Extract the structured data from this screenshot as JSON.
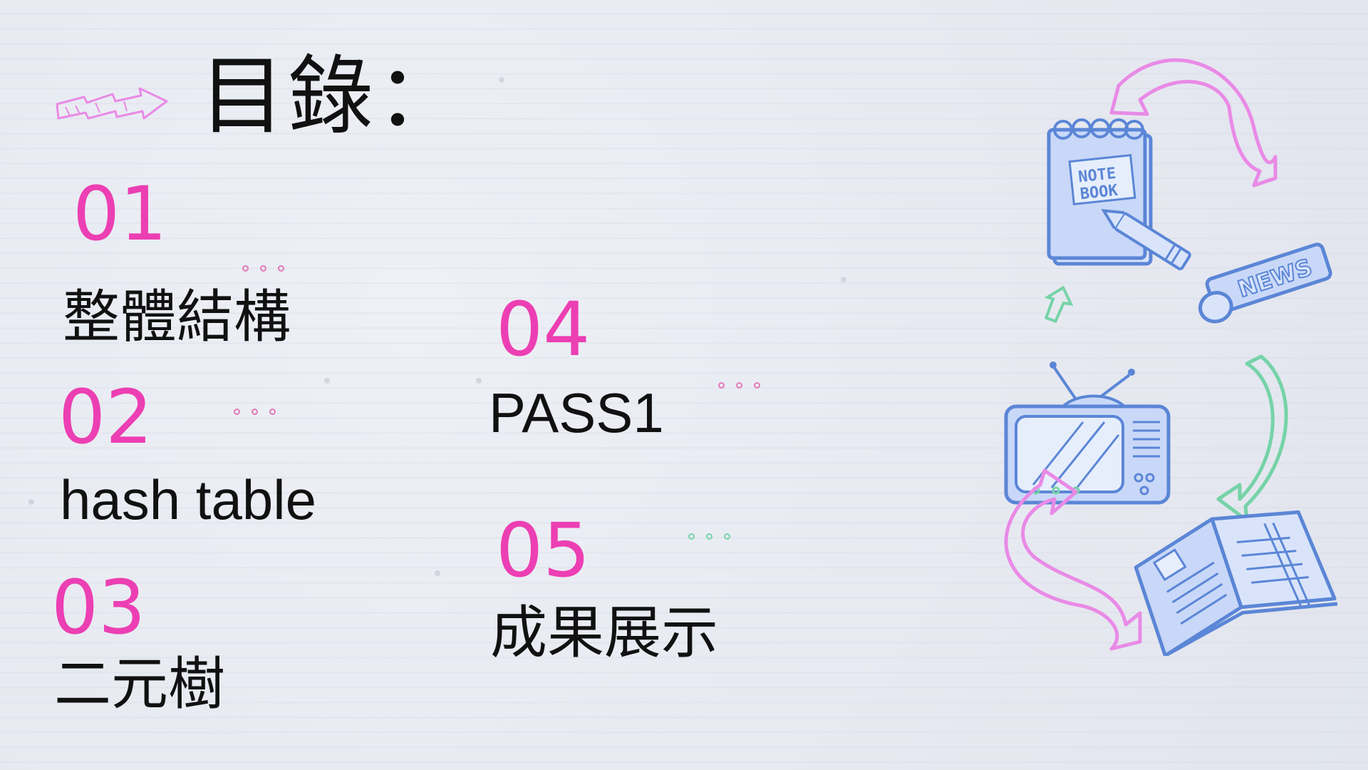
{
  "title": "目錄：",
  "items": [
    {
      "number": "01",
      "label": "整體結構"
    },
    {
      "number": "02",
      "label": "hash table"
    },
    {
      "number": "03",
      "label": "二元樹"
    },
    {
      "number": "04",
      "label": "PASS1"
    },
    {
      "number": "05",
      "label": "成果展示"
    }
  ],
  "illustrations": {
    "notebook_text_line1": "NOTE",
    "notebook_text_line2": "BOOK",
    "newspaper_text": "NEWS"
  },
  "colors": {
    "accent_pink": "#ec3fb3",
    "doodle_blue": "#5b86d6",
    "doodle_pink": "#e98ae6",
    "doodle_green": "#76d3a8"
  },
  "icons": [
    "arrow-doodle-icon",
    "notebook-icon",
    "newspaper-icon",
    "tv-icon",
    "open-book-icon",
    "curved-arrow-icon"
  ]
}
